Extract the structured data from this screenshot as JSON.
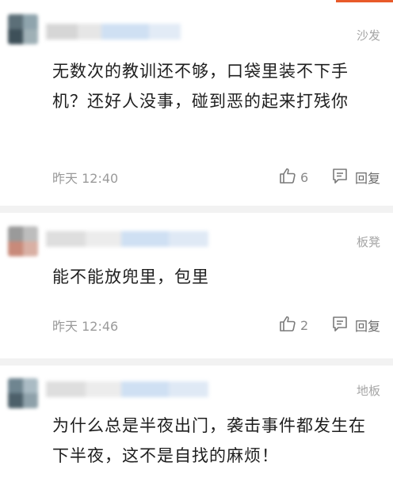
{
  "comments": [
    {
      "location": "沙发",
      "text": "无数次的教训还不够，口袋里装不下手机？还好人没事，碰到恶的起来打残你",
      "time": "昨天 12:40",
      "likes": "6",
      "reply_label": "回复"
    },
    {
      "location": "板凳",
      "text": "能不能放兜里，包里",
      "time": "昨天 12:46",
      "likes": "2",
      "reply_label": "回复"
    },
    {
      "location": "地板",
      "text": "为什么总是半夜出门，袭击事件都发生在下半夜，这不是自找的麻烦！"
    }
  ],
  "icons": {
    "like": "thumbs-up-icon",
    "reply": "comment-bubble-icon"
  },
  "colors": {
    "accent": "#e85a2a",
    "text": "#1e1e1e",
    "meta": "#9a9a9a",
    "icon": "#7a7a7a",
    "separator": "#f2f2f2"
  }
}
